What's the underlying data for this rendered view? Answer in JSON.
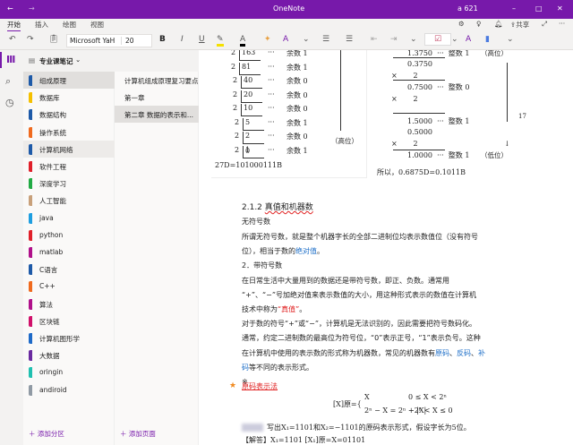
{
  "titlebar": {
    "title": "OneNote",
    "user": "a 621",
    "back": "←",
    "forward": "→",
    "minimize": "–",
    "maximize": "□",
    "close": "✕"
  },
  "tabs": [
    "开始",
    "插入",
    "绘图",
    "视图"
  ],
  "tabbar_right": {
    "share": "共享"
  },
  "toolbar": {
    "font": "Microsoft YaH",
    "size": "20",
    "bold": "B",
    "italic": "I",
    "underline": "U",
    "text_color": "A"
  },
  "notebook": {
    "name": "专业课笔记"
  },
  "sections": [
    {
      "label": "组成原理",
      "color": "#1e5aa8"
    },
    {
      "label": "数据库",
      "color": "#f5c000"
    },
    {
      "label": "数据结构",
      "color": "#1e5aa8"
    },
    {
      "label": "操作系统",
      "color": "#f06a1e"
    },
    {
      "label": "计算机网络",
      "color": "#1e5aa8"
    },
    {
      "label": "软件工程",
      "color": "#e0202a"
    },
    {
      "label": "深度学习",
      "color": "#22aa44"
    },
    {
      "label": "人工智能",
      "color": "#c8a07a"
    },
    {
      "label": "java",
      "color": "#1e9ee0"
    },
    {
      "label": "python",
      "color": "#e0202a"
    },
    {
      "label": "matlab",
      "color": "#b0108a"
    },
    {
      "label": "C语言",
      "color": "#1e5aa8"
    },
    {
      "label": "C++",
      "color": "#f06a1e"
    },
    {
      "label": "算法",
      "color": "#b0108a"
    },
    {
      "label": "区块链",
      "color": "#d0106a"
    },
    {
      "label": "计算机图形学",
      "color": "#1e6ac8"
    },
    {
      "label": "大数据",
      "color": "#6a2aa0"
    },
    {
      "label": "oringin",
      "color": "#20c0b0"
    },
    {
      "label": "andiroid",
      "color": "#909aa4"
    }
  ],
  "pages": [
    "计算机组成原理复习要点",
    "第一章",
    "第二章 数据的表示和..."
  ],
  "add_section": "添加分区",
  "add_page": "添加页面",
  "left_image": {
    "rows": [
      [
        "2",
        "163",
        "余数 1"
      ],
      [
        "2",
        "81",
        "余数 1"
      ],
      [
        "2",
        "40",
        "余数 0"
      ],
      [
        "2",
        "20",
        "余数 0"
      ],
      [
        "2",
        "10",
        "余数 0"
      ],
      [
        "2",
        "5",
        "余数 1"
      ],
      [
        "2",
        "2",
        "余数 0"
      ],
      [
        "2",
        "1",
        "余数 1"
      ]
    ],
    "zero": "0",
    "high": "（高位）",
    "result": "27D=101000111B"
  },
  "right_image": {
    "lines": [
      "1.3750  ···  整数 1",
      "0.3750",
      "×       2",
      "0.7500  ···  整数 0",
      "×       2",
      "1.5000  ···  整数 1",
      "0.5000",
      "×       2",
      "1.0000  ···  整数 1"
    ],
    "high": "（高位）",
    "low": "（低位）",
    "num": "17",
    "result": "所以，0.6875D=0.1011B"
  },
  "body": {
    "heading_num": "2.1.2 ",
    "heading": "真值和机器数",
    "l1": "无符号数",
    "l2": "所谓无符号数，就是整个机器字长的全部二进制位均表示数值位（没有符号",
    "l3a": "位），相当于数的",
    "l3b": "绝对值",
    "l3c": "。",
    "l4": "2．带符号数",
    "l5": "在日常生活中大量用到的数据还是带符号数，即正、负数。通常用",
    "l6": "“+”、“−”号加绝对值来表示数值的大小，用这种形式表示的数值在计算机",
    "l7a": "技术中称为",
    "l7b": "“真值”",
    "l7c": "。",
    "l8": "对于数的符号“+”或“−”，计算机是无法识别的，因此需要把符号数码化。",
    "l9": "通常，约定二进制数的最高位为符号位，“0”表示正号，“1”表示负号。这种",
    "l10a": "在计算机中使用的表示数的形式称为机器数，常见的机器数有",
    "l10b": "原码",
    "l10c": "、",
    "l10d": "反码",
    "l10e": "、",
    "l10f": "补",
    "l11a": "码",
    "l11b": "等不同的表示形式。",
    "mark": "※",
    "star_title": "原码表示法",
    "f_lhs": "[X]原={",
    "f1": "X",
    "f1c": "0 ≤ X < 2ⁿ",
    "f2": "2ⁿ − X = 2ⁿ + |X|",
    "f2c": "−2ⁿ < X ≤ 0",
    "ex": "写出X₁=1101和X₂=−1101的原码表示形式，假设字长为5位。",
    "ans": "【解答】X₁=1101        [X₁]原=X=01101"
  }
}
